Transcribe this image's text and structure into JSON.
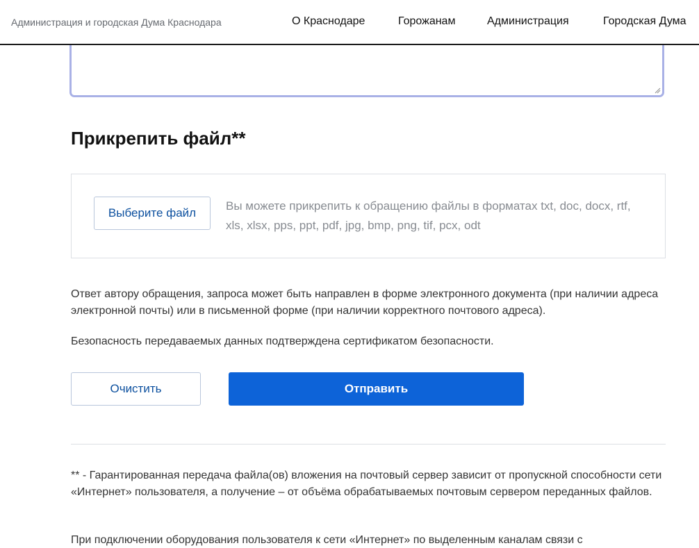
{
  "header": {
    "brand": "Администрация и городская Дума Краснодара",
    "nav": [
      "О Краснодаре",
      "Горожанам",
      "Администрация",
      "Городская Дума"
    ]
  },
  "form": {
    "attach_title": "Прикрепить файл**",
    "choose_file_label": "Выберите файл",
    "upload_hint": "Вы можете прикрепить к обращению файлы в форматах txt, doc, docx, rtf, xls, xlsx, pps, ppt, pdf, jpg, bmp, png, tif, pcx, odt",
    "answer_note": "Ответ автору обращения, запроса может быть направлен в форме электронного документа (при наличии адреса электронной почты) или в письменной форме (при наличии корректного почтового адреса).",
    "security_note": "Безопасность передаваемых данных подтверждена сертификатом безопасности.",
    "clear_label": "Очистить",
    "submit_label": "Отправить"
  },
  "footnotes": {
    "file_note": "** - Гарантированная передача файла(ов) вложения на почтовый сервер зависит от пропускной способности сети «Интернет» пользователя, а получение – от объёма обрабатываемых почтовым сервером переданных файлов.",
    "connection_note": "При подключении оборудования пользователя к сети «Интернет» по выделенным каналам связи с"
  },
  "colors": {
    "accent": "#0d63d8",
    "link": "#0b4f9e",
    "textarea_focus": "#a9b1e6"
  }
}
